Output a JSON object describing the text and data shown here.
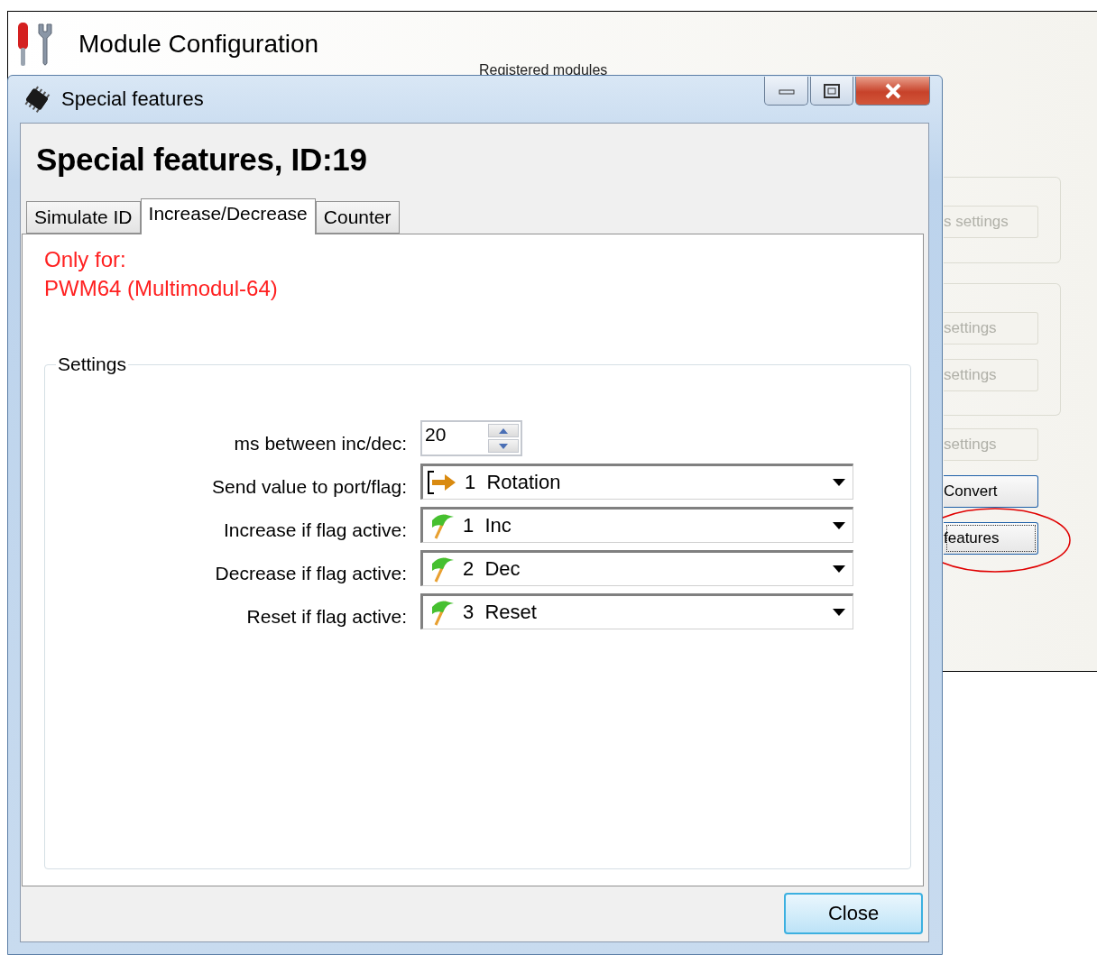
{
  "background_window": {
    "title": "Module Configuration",
    "group_label": "Registered modules",
    "groups": [
      {
        "buttons": [
          {
            "label": "s settings",
            "disabled": true
          }
        ]
      },
      {
        "buttons": [
          {
            "label": "settings",
            "disabled": true
          },
          {
            "label": "settings",
            "disabled": true
          }
        ]
      }
    ],
    "buttons": [
      {
        "label": "settings",
        "disabled": true,
        "focused": false
      },
      {
        "label": "Convert",
        "disabled": false,
        "focused": false
      },
      {
        "label": "features",
        "disabled": false,
        "focused": true
      }
    ]
  },
  "dialog": {
    "title": "Special features",
    "heading": "Special features, ID:19",
    "tabs": [
      {
        "label": "Simulate ID",
        "selected": false
      },
      {
        "label": "Increase/Decrease",
        "selected": true
      },
      {
        "label": "Counter",
        "selected": false
      }
    ],
    "notice": [
      "Only for:",
      "PWM64 (Multimodul-64)"
    ],
    "settings": {
      "title": "Settings",
      "spinner": {
        "label": "ms between inc/dec:",
        "value": "20"
      },
      "combos": [
        {
          "label": "Send value to port/flag:",
          "kind": "port",
          "value": "1  Rotation"
        },
        {
          "label": "Increase if flag active:",
          "kind": "flag",
          "value": "1  Inc"
        },
        {
          "label": "Decrease if flag active:",
          "kind": "flag",
          "value": "2  Dec"
        },
        {
          "label": "Reset if flag active:",
          "kind": "flag",
          "value": "3  Reset"
        }
      ]
    },
    "close_button": "Close"
  }
}
